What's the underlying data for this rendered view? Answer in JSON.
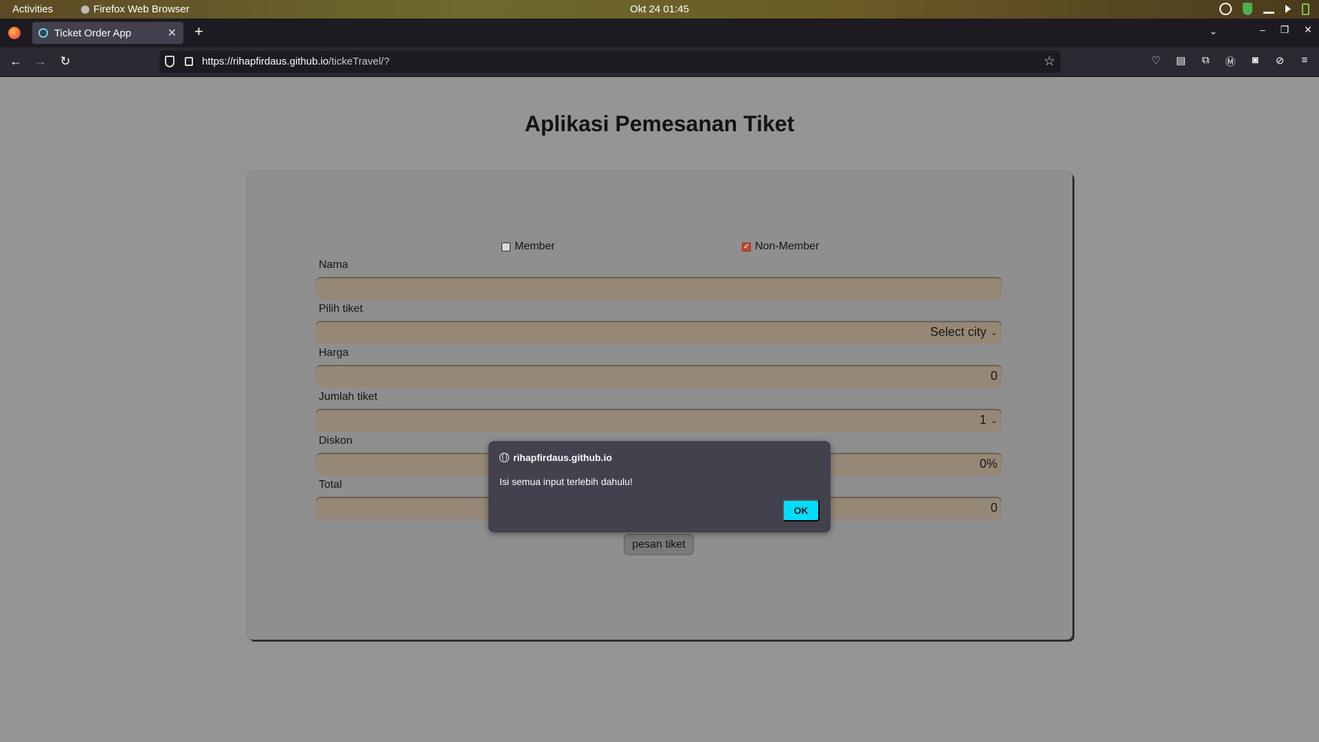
{
  "system_bar": {
    "activities": "Activities",
    "app_name": "Firefox Web Browser",
    "clock": "Okt 24  01:45",
    "tray_icons": [
      "app-indicator-icon",
      "shield-icon",
      "network-icon",
      "volume-icon",
      "battery-icon"
    ]
  },
  "browser": {
    "tab_title": "Ticket Order App",
    "new_tab": "+",
    "url_host": "https://rihapfirdaus.github.io",
    "url_path": "/tickeTravel/?"
  },
  "page": {
    "title": "Aplikasi Pemesanan Tiket",
    "checkboxes": [
      {
        "label": "Member",
        "checked": false
      },
      {
        "label": "Non-Member",
        "checked": true
      }
    ],
    "fields": [
      {
        "label": "Nama",
        "value": ""
      },
      {
        "label": "Pilih tiket",
        "value": "Select city"
      },
      {
        "label": "Harga",
        "value": "0"
      },
      {
        "label": "Jumlah tiket",
        "value": "1"
      },
      {
        "label": "Diskon",
        "value": "0%"
      },
      {
        "label": "Total",
        "value": "0"
      }
    ],
    "submit_label": "pesan tiket"
  },
  "dialog": {
    "origin": "rihapfirdaus.github.io",
    "message": "Isi semua input terlebih dahulu!",
    "ok_label": "OK"
  },
  "colors": {
    "page_bg": "#959595",
    "field_bg": "#968877",
    "checkbox_checked": "#c14a2f",
    "ok_button": "#00ddff"
  }
}
